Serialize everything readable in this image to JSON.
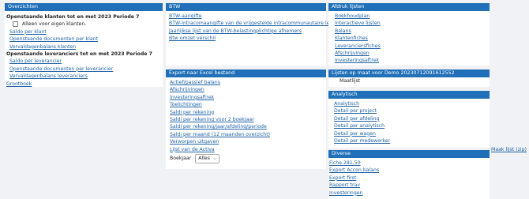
{
  "left": {
    "header": "Overzichten",
    "customers_title": "Openstaande klanten tot en met 2023 Periode 7",
    "own_customers_label": "Alleen voor eigen klanten.",
    "customer_links": [
      "Saldo per klant",
      "Openstaande documenten per klant",
      "Vervaldagenbalans klanten"
    ],
    "suppliers_title": "Openstaande leveranciers tot en met 2023 Periode 7",
    "supplier_links": [
      "Saldo per leverancier",
      "Openstaande documenten per leverancier",
      "Vervaldagenbalans leveranciers"
    ],
    "grootboek": "Grootboek"
  },
  "btw": {
    "header": "BTW",
    "links": [
      "BTW-aangifte",
      "BTW-Intracomaangifte van de vrijgestelde intracommunautaire leveringen",
      "Jaarlijkse lijst van de BTW-belastingplichtige afnemers",
      "Btw omzet verschil"
    ]
  },
  "excel": {
    "header": "Export naar Excel bestand",
    "links": [
      "Actief/passief balans",
      "Afschrijvingen",
      "Investeringsaftrek",
      "Toelichtingen",
      "Saldi per rekening",
      "Saldi per rekening voor 2 boekjaar",
      "Saldi per rekening/jaar/afdeling/periode",
      "Saldi per maand (12 maanden overzicht)",
      "Verworpen uitgaven",
      "Lijst van de Activa"
    ],
    "boekjaar_label": "Boekjaar",
    "boekjaar_value": "Alles"
  },
  "afdruk": {
    "header": "Afdruk lijsten",
    "links": [
      "Boekhoudplan",
      "Interactieve lijsten",
      "Balans",
      "Klantenfiches",
      "Leveranciersfiches",
      "Afschrijvingen",
      "Investeringsaftrek"
    ]
  },
  "maat": {
    "header": "Lijsten op maat voor Demo 20230712091612552",
    "item": "Maatlijst"
  },
  "analytisch": {
    "header": "Analytisch",
    "links": [
      "Analytisch",
      "Detail per project",
      "Detail per afdeling",
      "Detail per analytisch",
      "Detail per wagen",
      "Detail per medewerker"
    ]
  },
  "diverse": {
    "header": "Diverse",
    "links": [
      "Fiche 281.50",
      "Export Accon balans",
      "Export first",
      "Rapport trav",
      "Investeringen"
    ]
  },
  "maak_lijst": "Maak lijst (zip)"
}
